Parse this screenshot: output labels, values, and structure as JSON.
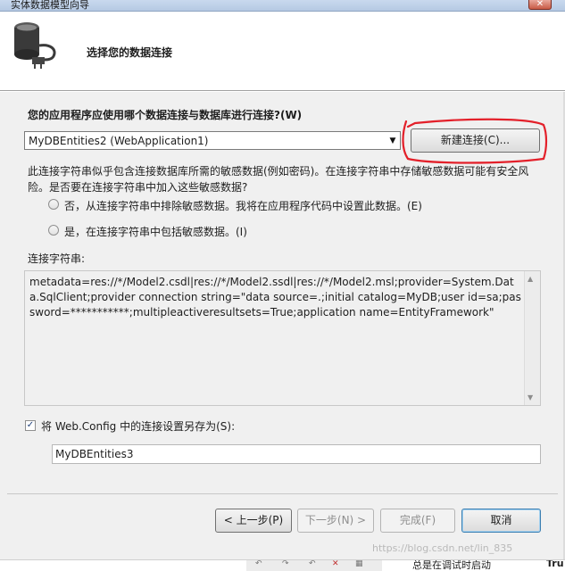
{
  "window": {
    "title": "实体数据模型向导",
    "close_glyph": "✕"
  },
  "header": {
    "heading": "选择您的数据连接"
  },
  "question": "您的应用程序应使用哪个数据连接与数据库进行连接?(W)",
  "connection_select": {
    "value": "MyDBEntities2 (WebApplication1)"
  },
  "new_connection_button": "新建连接(C)...",
  "annotation_color": "#e3202a",
  "sensitive_warning": "此连接字符串似乎包含连接数据库所需的敏感数据(例如密码)。在连接字符串中存储敏感数据可能有安全风险。是否要在连接字符串中加入这些敏感数据?",
  "radio_options": [
    {
      "label": "否，从连接字符串中排除敏感数据。我将在应用程序代码中设置此数据。(E)",
      "selected": false
    },
    {
      "label": "是，在连接字符串中包括敏感数据。(I)",
      "selected": false
    }
  ],
  "connection_string_label": "连接字符串:",
  "connection_string": "metadata=res://*/Model2.csdl|res://*/Model2.ssdl|res://*/Model2.msl;provider=System.Data.SqlClient;provider connection string=\"data source=.;initial catalog=MyDB;user id=sa;password=***********;multipleactiveresultsets=True;application name=EntityFramework\"",
  "save_checkbox": {
    "label": "将 Web.Config 中的连接设置另存为(S):",
    "checked": true
  },
  "entity_name": {
    "value": "MyDBEntities3"
  },
  "buttons": {
    "back": "< 上一步(P)",
    "next": "下一步(N) >",
    "finish": "完成(F)",
    "cancel": "取消"
  },
  "watermark": "https://blog.csdn.net/lin_835",
  "background_status": {
    "text": "总是在调试时启动",
    "right_text": "Tru"
  }
}
